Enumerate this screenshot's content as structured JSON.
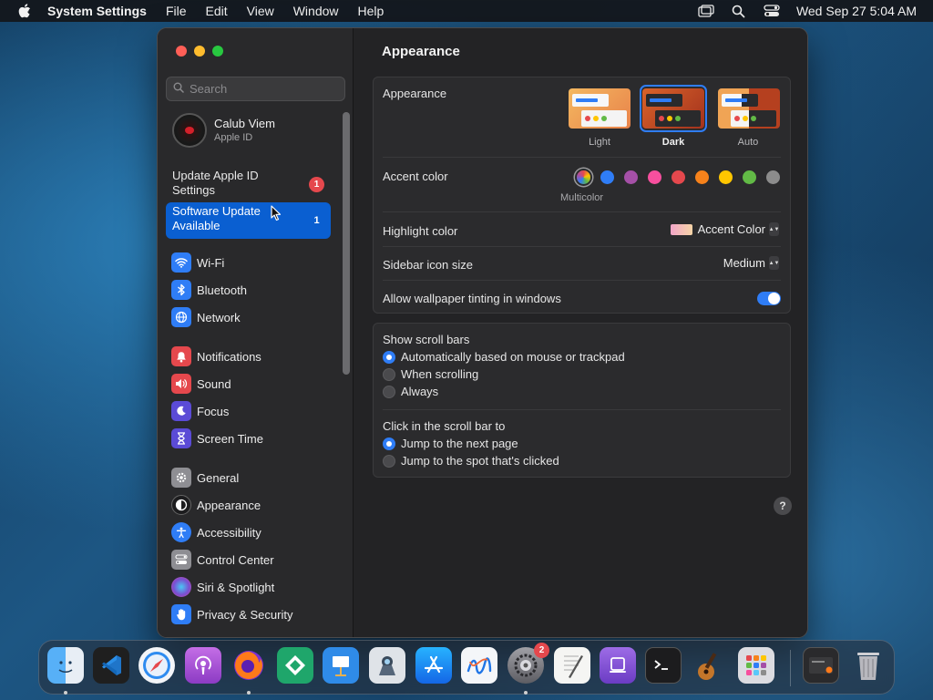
{
  "menubar": {
    "app_name": "System Settings",
    "menus": [
      "File",
      "Edit",
      "View",
      "Window",
      "Help"
    ],
    "clock": "Wed Sep 27  5:04 AM"
  },
  "sidebar": {
    "search_placeholder": "Search",
    "account": {
      "name": "Calub Viem",
      "subtitle": "Apple ID"
    },
    "notices": [
      {
        "label": "Update Apple ID Settings",
        "badge": "1"
      },
      {
        "label": "Software Update Available",
        "badge": "1"
      }
    ],
    "groups": [
      [
        {
          "label": "Wi-Fi",
          "icon": "wifi-icon",
          "color": "#2f7df6"
        },
        {
          "label": "Bluetooth",
          "icon": "bluetooth-icon",
          "color": "#2f7df6"
        },
        {
          "label": "Network",
          "icon": "globe-icon",
          "color": "#2f7df6"
        }
      ],
      [
        {
          "label": "Notifications",
          "icon": "bell-icon",
          "color": "#e5484d"
        },
        {
          "label": "Sound",
          "icon": "speaker-icon",
          "color": "#e5484d"
        },
        {
          "label": "Focus",
          "icon": "moon-icon",
          "color": "#5b4bd6"
        },
        {
          "label": "Screen Time",
          "icon": "hourglass-icon",
          "color": "#5b4bd6"
        }
      ],
      [
        {
          "label": "General",
          "icon": "gear-icon",
          "color": "#8e8e93"
        },
        {
          "label": "Appearance",
          "icon": "appearance-icon",
          "color": "#1c1c1e"
        },
        {
          "label": "Accessibility",
          "icon": "accessibility-icon",
          "color": "#2f7df6"
        },
        {
          "label": "Control Center",
          "icon": "control-center-icon",
          "color": "#8e8e93"
        },
        {
          "label": "Siri & Spotlight",
          "icon": "siri-icon",
          "color": "#7a4fd1"
        },
        {
          "label": "Privacy & Security",
          "icon": "hand-icon",
          "color": "#2f7df6"
        }
      ]
    ]
  },
  "main": {
    "title": "Appearance",
    "appearance": {
      "label": "Appearance",
      "options": [
        "Light",
        "Dark",
        "Auto"
      ],
      "selected": "Dark"
    },
    "accent": {
      "label": "Accent color",
      "selected_caption": "Multicolor",
      "colors": [
        "#2f7df6",
        "#a550a7",
        "#f74f9e",
        "#e5484d",
        "#f7821b",
        "#ffc600",
        "#62ba46",
        "#8c8c8c"
      ]
    },
    "highlight": {
      "label": "Highlight color",
      "value": "Accent Color"
    },
    "sidebar_icon_size": {
      "label": "Sidebar icon size",
      "value": "Medium"
    },
    "wallpaper_tinting": {
      "label": "Allow wallpaper tinting in windows",
      "on": true
    },
    "scroll_bars": {
      "label": "Show scroll bars",
      "options": [
        "Automatically based on mouse or trackpad",
        "When scrolling",
        "Always"
      ],
      "selected": 0
    },
    "click_scroll": {
      "label": "Click in the scroll bar to",
      "options": [
        "Jump to the next page",
        "Jump to the spot that's clicked"
      ],
      "selected": 0
    },
    "help": "?"
  },
  "dock": {
    "apps": [
      {
        "name": "Finder",
        "icon": "finder-icon",
        "color": "#3a8ef6",
        "running": true
      },
      {
        "name": "Visual Studio Code",
        "icon": "vscode-icon",
        "color": "#1f75c9",
        "running": false
      },
      {
        "name": "Safari",
        "icon": "safari-icon",
        "color": "#e9f1f9",
        "running": false
      },
      {
        "name": "Podcasts",
        "icon": "podcasts-icon",
        "color": "#a34ed1",
        "running": false
      },
      {
        "name": "Firefox",
        "icon": "firefox-icon",
        "color": "#e8572a",
        "running": true
      },
      {
        "name": "Tableau",
        "icon": "tableau-icon",
        "color": "#1fa66b",
        "running": false
      },
      {
        "name": "Keynote",
        "icon": "keynote-icon",
        "color": "#2f8be8",
        "running": false
      },
      {
        "name": "Preview",
        "icon": "preview-icon",
        "color": "#dfe3e8",
        "running": false
      },
      {
        "name": "App Store",
        "icon": "app-store-icon",
        "color": "#1e8ef5",
        "running": false
      },
      {
        "name": "Freeform",
        "icon": "freeform-icon",
        "color": "#f4f6f9",
        "running": false
      },
      {
        "name": "System Settings",
        "icon": "system-settings-icon",
        "color": "#8e8e93",
        "running": true,
        "badge": "2"
      },
      {
        "name": "TextEdit",
        "icon": "textedit-icon",
        "color": "#f2f2f2",
        "running": false
      },
      {
        "name": "Podcasts Purple",
        "icon": "purple-app-icon",
        "color": "#8d5ad8",
        "running": false
      },
      {
        "name": "Terminal",
        "icon": "terminal-icon",
        "color": "#1e1e1e",
        "running": false
      },
      {
        "name": "GarageBand",
        "icon": "garageband-icon",
        "color": "#3a2a1e",
        "running": false
      },
      {
        "name": "Launchpad",
        "icon": "launchpad-icon",
        "color": "#d9d9de",
        "running": false
      }
    ],
    "extras": [
      {
        "name": "Downloads",
        "icon": "downloads-stack-icon"
      },
      {
        "name": "Trash",
        "icon": "trash-icon"
      }
    ]
  }
}
